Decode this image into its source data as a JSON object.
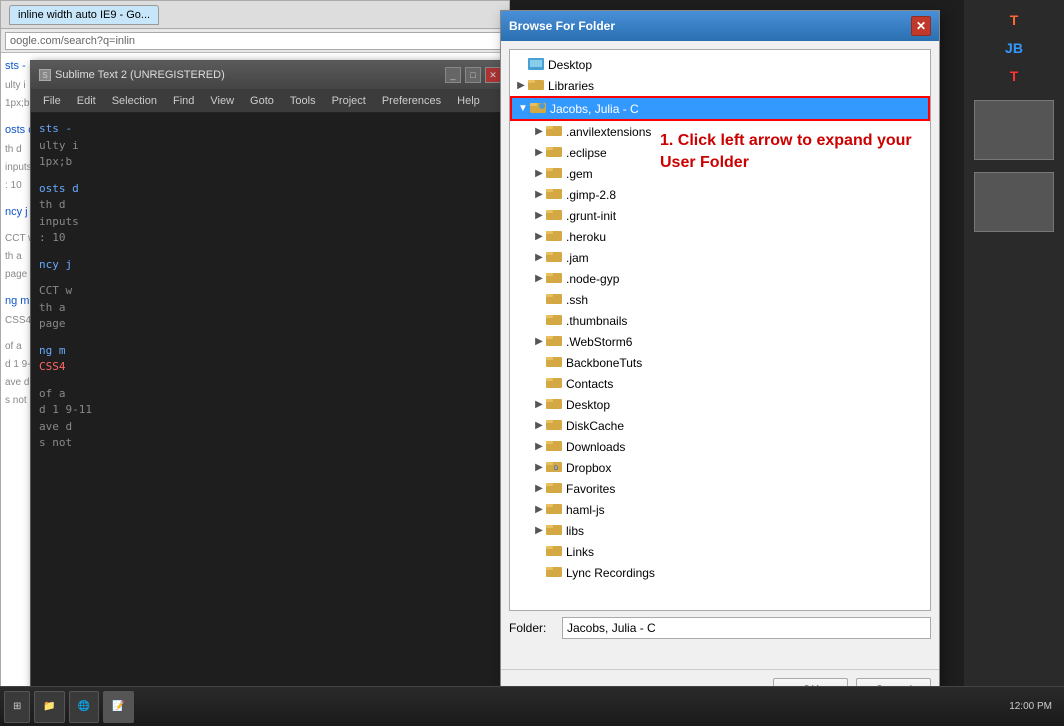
{
  "browser": {
    "tab_label": "inline width auto IE9 - Go...",
    "url": "oogle.com/search?q=inlin"
  },
  "sublime": {
    "title": "Sublime Text 2 (UNREGISTERED)",
    "menu_items": [
      "File",
      "Edit",
      "Selection",
      "Find",
      "View",
      "Goto",
      "Tools",
      "Project",
      "Preferences",
      "Help"
    ],
    "code_lines": [
      "sts -",
      "ulty i",
      "1px;b",
      "",
      "osts",
      "d",
      "th d",
      "inputs",
      ": 10",
      "",
      "ncy j",
      "",
      "CCT w",
      "th a",
      "pag"
    ]
  },
  "dialog": {
    "title": "Browse For Folder",
    "close_btn": "✕",
    "tree_items": [
      {
        "id": "desktop-top",
        "label": "Desktop",
        "indent": 0,
        "has_arrow": false,
        "arrow_dir": "",
        "folder_type": "special"
      },
      {
        "id": "libraries",
        "label": "Libraries",
        "indent": 0,
        "has_arrow": true,
        "arrow_dir": "right",
        "folder_type": "special"
      },
      {
        "id": "jacobs-julia",
        "label": "Jacobs, Julia - C",
        "indent": 0,
        "has_arrow": true,
        "arrow_dir": "down",
        "folder_type": "user",
        "selected": true
      },
      {
        "id": "anvilextensions",
        "label": ".anvilextensions",
        "indent": 1,
        "has_arrow": true,
        "arrow_dir": "right",
        "folder_type": "normal"
      },
      {
        "id": "eclipse",
        "label": ".eclipse",
        "indent": 1,
        "has_arrow": true,
        "arrow_dir": "right",
        "folder_type": "normal"
      },
      {
        "id": "gem",
        "label": ".gem",
        "indent": 1,
        "has_arrow": true,
        "arrow_dir": "right",
        "folder_type": "normal"
      },
      {
        "id": "gimp28",
        "label": ".gimp-2.8",
        "indent": 1,
        "has_arrow": true,
        "arrow_dir": "right",
        "folder_type": "normal"
      },
      {
        "id": "grunt-init",
        "label": ".grunt-init",
        "indent": 1,
        "has_arrow": true,
        "arrow_dir": "right",
        "folder_type": "normal"
      },
      {
        "id": "heroku",
        "label": ".heroku",
        "indent": 1,
        "has_arrow": true,
        "arrow_dir": "right",
        "folder_type": "normal"
      },
      {
        "id": "jam",
        "label": ".jam",
        "indent": 1,
        "has_arrow": true,
        "arrow_dir": "right",
        "folder_type": "normal"
      },
      {
        "id": "node-gyp",
        "label": ".node-gyp",
        "indent": 1,
        "has_arrow": true,
        "arrow_dir": "right",
        "folder_type": "normal"
      },
      {
        "id": "ssh",
        "label": ".ssh",
        "indent": 1,
        "has_arrow": false,
        "arrow_dir": "",
        "folder_type": "normal"
      },
      {
        "id": "thumbnails",
        "label": ".thumbnails",
        "indent": 1,
        "has_arrow": false,
        "arrow_dir": "",
        "folder_type": "normal"
      },
      {
        "id": "webstorm6",
        "label": ".WebStorm6",
        "indent": 1,
        "has_arrow": true,
        "arrow_dir": "right",
        "folder_type": "normal"
      },
      {
        "id": "backbonetuts",
        "label": "BackboneTuts",
        "indent": 1,
        "has_arrow": false,
        "arrow_dir": "",
        "folder_type": "normal"
      },
      {
        "id": "contacts",
        "label": "Contacts",
        "indent": 1,
        "has_arrow": false,
        "arrow_dir": "",
        "folder_type": "normal"
      },
      {
        "id": "desktop",
        "label": "Desktop",
        "indent": 1,
        "has_arrow": true,
        "arrow_dir": "right",
        "folder_type": "normal"
      },
      {
        "id": "diskcache",
        "label": "DiskCache",
        "indent": 1,
        "has_arrow": true,
        "arrow_dir": "right",
        "folder_type": "normal"
      },
      {
        "id": "downloads",
        "label": "Downloads",
        "indent": 1,
        "has_arrow": true,
        "arrow_dir": "right",
        "folder_type": "normal"
      },
      {
        "id": "dropbox",
        "label": "Dropbox",
        "indent": 1,
        "has_arrow": true,
        "arrow_dir": "right",
        "folder_type": "dropbox"
      },
      {
        "id": "favorites",
        "label": "Favorites",
        "indent": 1,
        "has_arrow": true,
        "arrow_dir": "right",
        "folder_type": "normal"
      },
      {
        "id": "haml-js",
        "label": "haml-js",
        "indent": 1,
        "has_arrow": true,
        "arrow_dir": "right",
        "folder_type": "normal"
      },
      {
        "id": "libs",
        "label": "libs",
        "indent": 1,
        "has_arrow": true,
        "arrow_dir": "right",
        "folder_type": "normal"
      },
      {
        "id": "links",
        "label": "Links",
        "indent": 1,
        "has_arrow": false,
        "arrow_dir": "",
        "folder_type": "normal"
      },
      {
        "id": "lync-recordings",
        "label": "Lync Recordings",
        "indent": 1,
        "has_arrow": false,
        "arrow_dir": "",
        "folder_type": "normal"
      }
    ],
    "folder_label": "Folder:",
    "folder_value": "Jacobs, Julia - C",
    "ok_button": "OK",
    "cancel_button": "Cancel"
  },
  "callout": {
    "text": "1. Click left arrow to expand your User Folder"
  },
  "taskbar": {
    "buttons": [
      "⊞",
      "📁",
      "🌐",
      "📝"
    ]
  }
}
